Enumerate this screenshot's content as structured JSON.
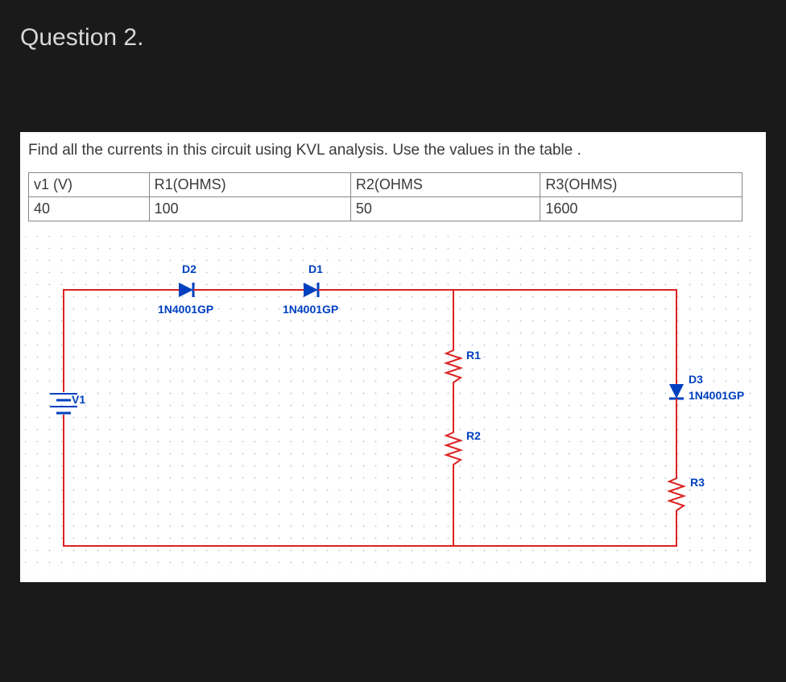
{
  "question": {
    "title": "Question 2.",
    "instruction": "Find all the currents in this circuit using KVL analysis. Use the values in the table ."
  },
  "table": {
    "headers": [
      "v1 (V)",
      "R1(OHMS)",
      "R2(OHMS",
      "R3(OHMS)"
    ],
    "values": [
      "40",
      "100",
      "50",
      "1600"
    ]
  },
  "circuit": {
    "source": {
      "name": "V1"
    },
    "diodes": {
      "d1": {
        "name": "D1",
        "model": "1N4001GP"
      },
      "d2": {
        "name": "D2",
        "model": "1N4001GP"
      },
      "d3": {
        "name": "D3",
        "model": "1N4001GP"
      }
    },
    "resistors": {
      "r1": {
        "name": "R1"
      },
      "r2": {
        "name": "R2"
      },
      "r3": {
        "name": "R3"
      }
    }
  }
}
